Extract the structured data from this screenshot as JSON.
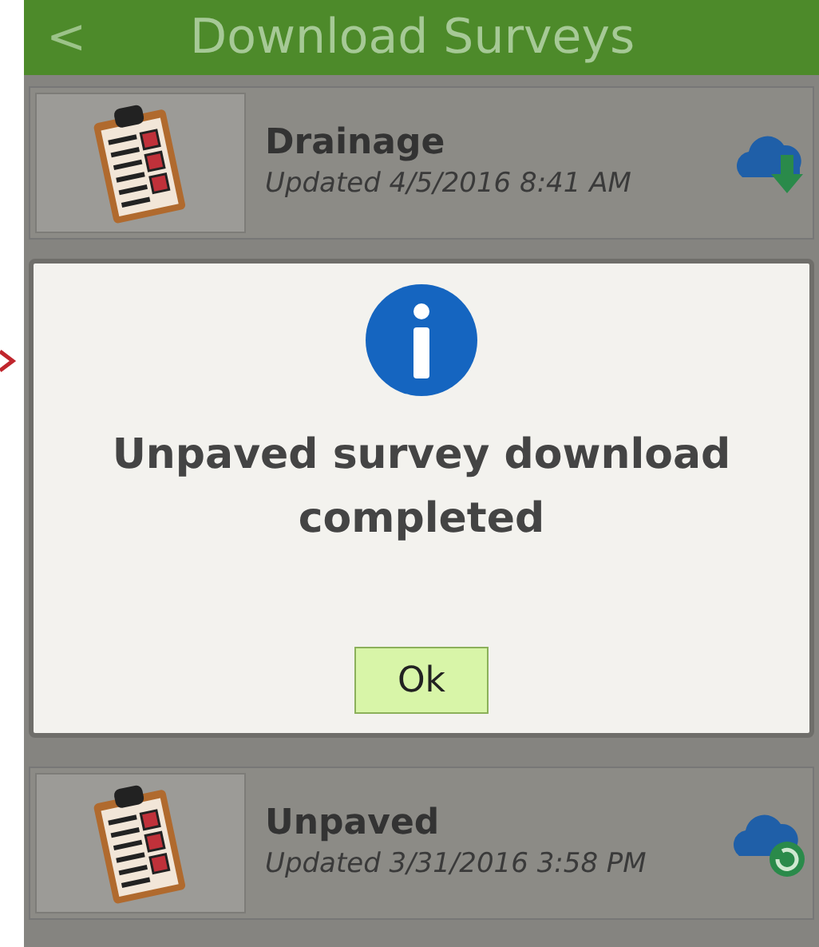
{
  "header": {
    "back": "<",
    "title": "Download Surveys"
  },
  "surveys": [
    {
      "name": "Drainage",
      "updated": "Updated 4/5/2016 8:41 AM",
      "kind": "download"
    },
    {
      "name": "Unpaved",
      "updated": "Updated 3/31/2016 3:58 PM",
      "kind": "sync"
    }
  ],
  "dialog": {
    "message": "Unpaved survey download completed",
    "button": "Ok"
  }
}
